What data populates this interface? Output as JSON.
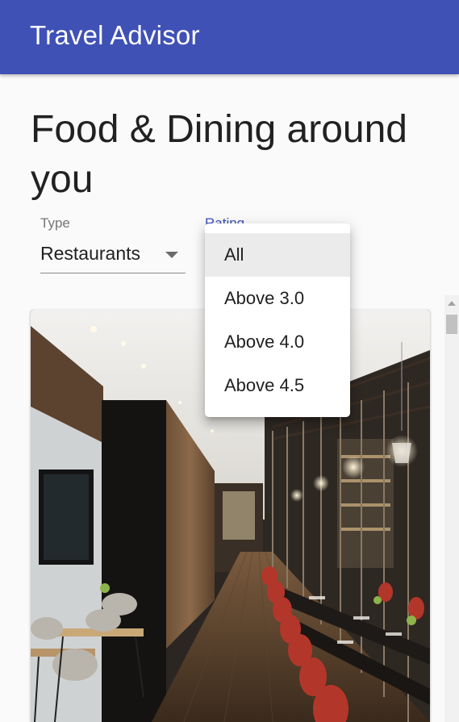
{
  "appbar": {
    "title": "Travel Advisor",
    "color": "#3f51b5"
  },
  "heading": "Food & Dining around you",
  "filters": {
    "type": {
      "label": "Type",
      "value": "Restaurants"
    },
    "rating": {
      "label": "Rating",
      "options": [
        "All",
        "Above 3.0",
        "Above 4.0",
        "Above 4.5"
      ],
      "selected": "All"
    }
  },
  "card": {
    "image": "restaurant-interior-photo"
  }
}
